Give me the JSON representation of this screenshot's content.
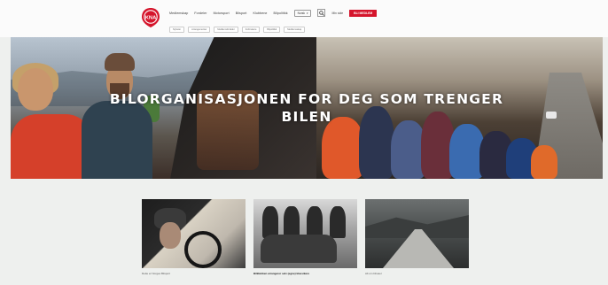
{
  "header": {
    "logo_text": "KNA",
    "nav_items": [
      "Medlemskap",
      "Fordeler",
      "Motorsport",
      "Bilsport",
      "Klubbene",
      "Bilpolitikk"
    ],
    "language": "Norsk",
    "login_label": "Min side",
    "cta_label": "BLI MEDLEM",
    "subnav_items": [
      "Nyheter",
      "Arrangementer",
      "Medlemsfordeler",
      "Forbrukere",
      "Bilpolitikk",
      "Medlemsskap"
    ],
    "brand_color": "#d5152c"
  },
  "hero": {
    "title_line1": "BILORGANISASJONEN FOR DEG SOM TRENGER",
    "title_line2": "BILEN"
  },
  "cards": [
    {
      "caption": "Dette er Norges Bilsport"
    },
    {
      "caption": "Bilklubben arrangerer selv (egne) klassikere",
      "bold": true
    },
    {
      "caption": "Alt om bilveier"
    }
  ]
}
